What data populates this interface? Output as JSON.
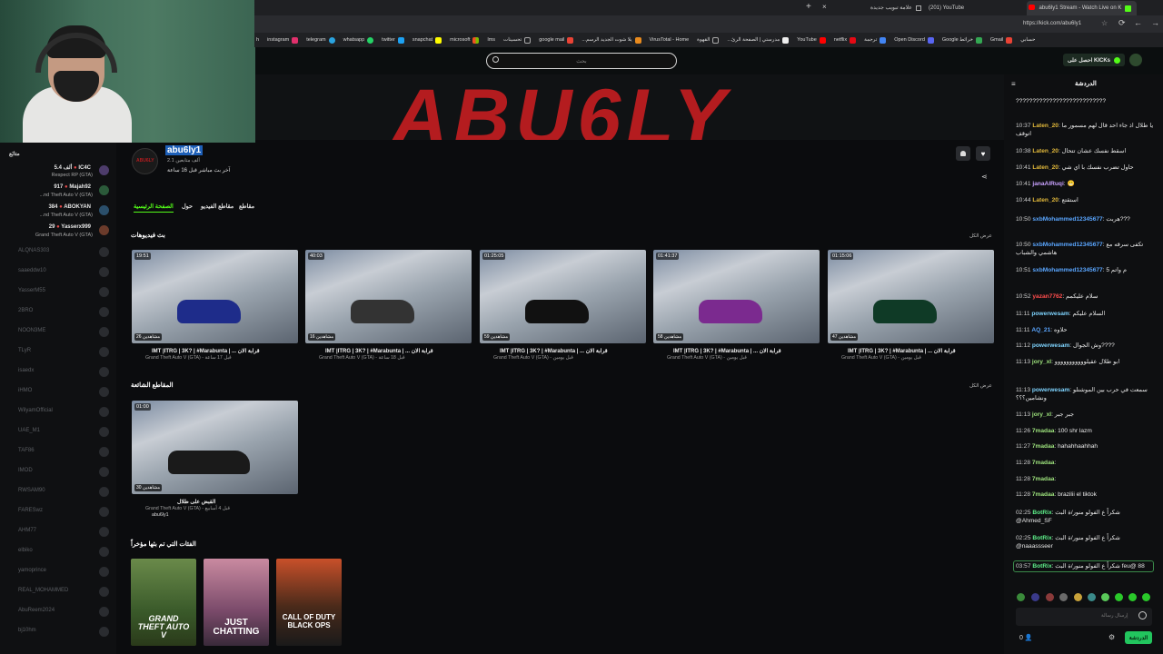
{
  "browser": {
    "tabs": [
      {
        "title": "علامة تبويب جديدة"
      },
      {
        "title": "(201) YouTube"
      },
      {
        "title": "abu6ly1 Stream - Watch Live on K"
      }
    ],
    "url": "https://kick.com/abu6ly1",
    "bookmarks": [
      {
        "label": "instagram",
        "color": "#e1306c"
      },
      {
        "label": "telegram",
        "color": "#2aa3df"
      },
      {
        "label": "whatsapp",
        "color": "#25d366"
      },
      {
        "label": "twitter",
        "color": "#1da1f2"
      },
      {
        "label": "snapchat",
        "color": "#fffc00"
      },
      {
        "label": "microsoft",
        "color": "#f25022"
      },
      {
        "label": "lms",
        "color": "#4a7bd1"
      },
      {
        "label": "تحسينات",
        "color": "#888888"
      },
      {
        "label": "google mail",
        "color": "#ea4335"
      },
      {
        "label": "...يلا شوت الجديد الرسم",
        "color": "#e98b1e"
      },
      {
        "label": "VirusTotal - Home",
        "color": "#3c5bd8"
      },
      {
        "label": "القهوة",
        "color": "#8b5a2b"
      },
      {
        "label": "...مدرستي | الصفحة الرئ",
        "color": "#6a6a6a"
      },
      {
        "label": "YouTube",
        "color": "#ff0000"
      },
      {
        "label": "netflix",
        "color": "#e50914"
      },
      {
        "label": "ترجمة",
        "color": "#4285f4"
      },
      {
        "label": "Open Discord",
        "color": "#5865f2"
      },
      {
        "label": "Google خرائط",
        "color": "#34a853"
      },
      {
        "label": "Gmail",
        "color": "#ea4335"
      },
      {
        "label": "حسابي",
        "color": "#34a853"
      }
    ]
  },
  "header": {
    "search_placeholder": "بحث",
    "get_kicks": "احصل على KICKs"
  },
  "banner": {
    "text": "ABU6LY"
  },
  "channel": {
    "name": "abu6ly1",
    "followers": "2.1 ألف متابعين",
    "last_live": "آخر بث مباشر قبل 16 ساعة",
    "tabs": [
      "الصفحة الرئيسية",
      "حول",
      "مقاطع الفيديو",
      "مقاطع"
    ],
    "streams_heading": "بث فيديوهات",
    "show_all": "عرض الكل",
    "clips_heading": "المقاطع الشائعة",
    "categories_heading": "الفئات التي تم بثها مؤخراً"
  },
  "videos": [
    {
      "duration": "19:51",
      "views": "26 مشاهدين",
      "title": "IMT |ITRG | 3K? | #Marabunta | ... قرابة الان",
      "meta": "Grand Theft Auto V (GTA) - قبل 17 ساعة",
      "accent": "#1e2c8a"
    },
    {
      "duration": "40:03",
      "views": "16 مشاهدين",
      "title": "IMT |ITRG | 3K? | #Marabunta | ... قرابة الان",
      "meta": "Grand Theft Auto V (GTA) - قبل 18 ساعة",
      "accent": "#333333"
    },
    {
      "duration": "01:25:05",
      "views": "59 مشاهدين",
      "title": "IMT |ITRG | 3K? | #Marabunta | ... قرابة الان",
      "meta": "Grand Theft Auto V (GTA) - قبل يومين",
      "accent": "#111111"
    },
    {
      "duration": "01:41:37",
      "views": "58 مشاهدين",
      "title": "IMT |ITRG | 3K? | #Marabunta | ... قرابة الان",
      "meta": "Grand Theft Auto V (GTA) - قبل يومين",
      "accent": "#7b2a8f"
    },
    {
      "duration": "01:15:06",
      "views": "47 مشاهدين",
      "title": "IMT |ITRG | 3K? | #Marabunta | ... قرابة الان",
      "meta": "Grand Theft Auto V (GTA) - قبل يومين",
      "accent": "#0f3a26"
    }
  ],
  "clip": {
    "duration": "01:00",
    "views": "30 مشاهدين",
    "title": "القبض على طلال",
    "meta": "Grand Theft Auto V (GTA) - قبل 4 أسابيع",
    "author": "abu6ly1"
  },
  "categories": [
    {
      "label": "GRAND THEFT AUTO V",
      "bg": "#3a5a2a"
    },
    {
      "label": "JUST CHATTING",
      "bg": "#7a4a6a"
    },
    {
      "label": "CALL OF DUTY BLACK OPS",
      "bg": "#4a2a1a"
    }
  ],
  "sidebar": {
    "heading": "متابَع",
    "live": [
      {
        "name": "IC4C",
        "viewers": "5.4 ألف",
        "game": "Respect RP (GTA)"
      },
      {
        "name": "Majah92",
        "viewers": "917",
        "game": "...nd Theft Auto V (GTA)"
      },
      {
        "name": "ABOKYAN",
        "viewers": "384",
        "game": "...nd Theft Auto V (GTA)"
      },
      {
        "name": "Yasserx999",
        "viewers": "29",
        "game": "Grand Theft Auto V (GTA)"
      }
    ],
    "offline": [
      "ALQNAS303",
      "saaeddw10",
      "YasserM55",
      "2BRO",
      "NOON3ME",
      "TLyR",
      "isaedx",
      "iHMO",
      "WilyamOfficial",
      "UAE_M1",
      "TAF86",
      "IMOD",
      "RWSAM90",
      "FARESwz",
      "AHM77",
      "elbiko",
      "yamoprince",
      "REAL_MOHAMMED",
      "AbuReem2024",
      "bj10hm"
    ]
  },
  "chat": {
    "heading": "الدردشة",
    "input_placeholder": "إرسال رسالة",
    "send_label": "الدردشة",
    "users_count": "0",
    "messages": [
      {
        "time": "",
        "user": "",
        "user_color": "#e9e9e9",
        "text": "???????????????????????????"
      },
      {
        "time": "10:37",
        "user": "Laten_20",
        "user_color": "#e2b93b",
        "text": "يا طلال اذ جاء احد قال لهم مسمور ما اتوقف"
      },
      {
        "time": "10:38",
        "user": "Laten_20",
        "user_color": "#e2b93b",
        "text": "اسقط نفسك عشان تتحال"
      },
      {
        "time": "10:41",
        "user": "Laten_20",
        "user_color": "#e2b93b",
        "text": "حاول تضرب نفسك با اي شي"
      },
      {
        "time": "10:41",
        "user": "janaAlRuqi",
        "user_color": "#c9a2ff",
        "text": "😬"
      },
      {
        "time": "10:44",
        "user": "Laten_20",
        "user_color": "#e2b93b",
        "text": "استقتع"
      },
      {
        "time": "10:50",
        "user": "sxbMohammed12345677",
        "user_color": "#5aa6ff",
        "text": "هربت???"
      },
      {
        "time": "10:50",
        "user": "sxbMohammed12345677",
        "user_color": "#5aa6ff",
        "text": "تكفى سرقه مع هاشمي والشباب"
      },
      {
        "time": "10:51",
        "user": "sxbMohammed12345677",
        "user_color": "#5aa6ff",
        "text": "5 م واتم"
      },
      {
        "time": "10:52",
        "user": "yazan7762",
        "user_color": "#ff4d4d",
        "text": "سلام عليكمم"
      },
      {
        "time": "11:11",
        "user": "powerwesam",
        "user_color": "#7fd4ff",
        "text": "السلام عليكم"
      },
      {
        "time": "11:11",
        "user": "AQ_21",
        "user_color": "#5aa6ff",
        "text": "حلاوه"
      },
      {
        "time": "11:12",
        "user": "powerwesam",
        "user_color": "#7fd4ff",
        "text": "وش الجوال????"
      },
      {
        "time": "11:13",
        "user": "jory_xl",
        "user_color": "#9ee37d",
        "text": "ابو طلال عقيلووووووووووو"
      },
      {
        "time": "11:13",
        "user": "powerwesam",
        "user_color": "#7fd4ff",
        "text": "سمعت في حرب بين الموشنلو ونشامين؟؟؟"
      },
      {
        "time": "11:13",
        "user": "jory_xl",
        "user_color": "#9ee37d",
        "text": "جبر جبر"
      },
      {
        "time": "11:26",
        "user": "7madaa",
        "user_color": "#9ee37d",
        "text": "100 shr lazm"
      },
      {
        "time": "11:27",
        "user": "7madaa",
        "user_color": "#9ee37d",
        "text": "hahahhaahhah"
      },
      {
        "time": "11:28",
        "user": "7madaa",
        "user_color": "#9ee37d",
        "text": ""
      },
      {
        "time": "11:28",
        "user": "7madaa",
        "user_color": "#9ee37d",
        "text": ""
      },
      {
        "time": "11:28",
        "user": "7madaa",
        "user_color": "#9ee37d",
        "text": "brazilii el tiktok"
      },
      {
        "time": "02:25",
        "user": "BotRix",
        "user_color": "#5ef08a",
        "text": "شكراً ع الفولو منور/ة البث @Ahmed_SF"
      },
      {
        "time": "02:25",
        "user": "BotRix",
        "user_color": "#5ef08a",
        "text": "شكراً ع الفولو منور/ة البث @naaassseer"
      },
      {
        "time": "03:57",
        "user": "BotRix",
        "user_color": "#5ef08a",
        "text": "شكراً ع الفولو منور/ة البث feu@ 88"
      }
    ]
  }
}
